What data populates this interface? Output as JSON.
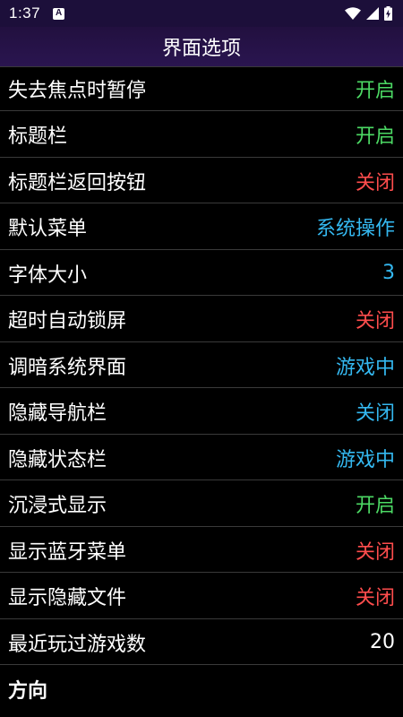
{
  "status_bar": {
    "time": "1:37",
    "notification_letter": "A",
    "icons": [
      "wifi-icon",
      "signal-icon",
      "battery-charging-icon"
    ]
  },
  "title": "界面选项",
  "colors": {
    "on": "#4cd964",
    "off": "#ff4d4d",
    "info": "#34b8f0",
    "plain": "#ffffff"
  },
  "items": [
    {
      "label": "失去焦点时暂停",
      "value": "开启",
      "state": "on"
    },
    {
      "label": "标题栏",
      "value": "开启",
      "state": "on"
    },
    {
      "label": "标题栏返回按钮",
      "value": "关闭",
      "state": "off"
    },
    {
      "label": "默认菜单",
      "value": "系统操作",
      "state": "info"
    },
    {
      "label": "字体大小",
      "value": "3",
      "state": "info"
    },
    {
      "label": "超时自动锁屏",
      "value": "关闭",
      "state": "off"
    },
    {
      "label": "调暗系统界面",
      "value": "游戏中",
      "state": "info"
    },
    {
      "label": "隐藏导航栏",
      "value": "关闭",
      "state": "info"
    },
    {
      "label": "隐藏状态栏",
      "value": "游戏中",
      "state": "info"
    },
    {
      "label": "沉浸式显示",
      "value": "开启",
      "state": "on"
    },
    {
      "label": "显示蓝牙菜单",
      "value": "关闭",
      "state": "off"
    },
    {
      "label": "显示隐藏文件",
      "value": "关闭",
      "state": "off"
    },
    {
      "label": "最近玩过游戏数",
      "value": "20",
      "state": "plain"
    }
  ],
  "section": {
    "label": "方向"
  }
}
